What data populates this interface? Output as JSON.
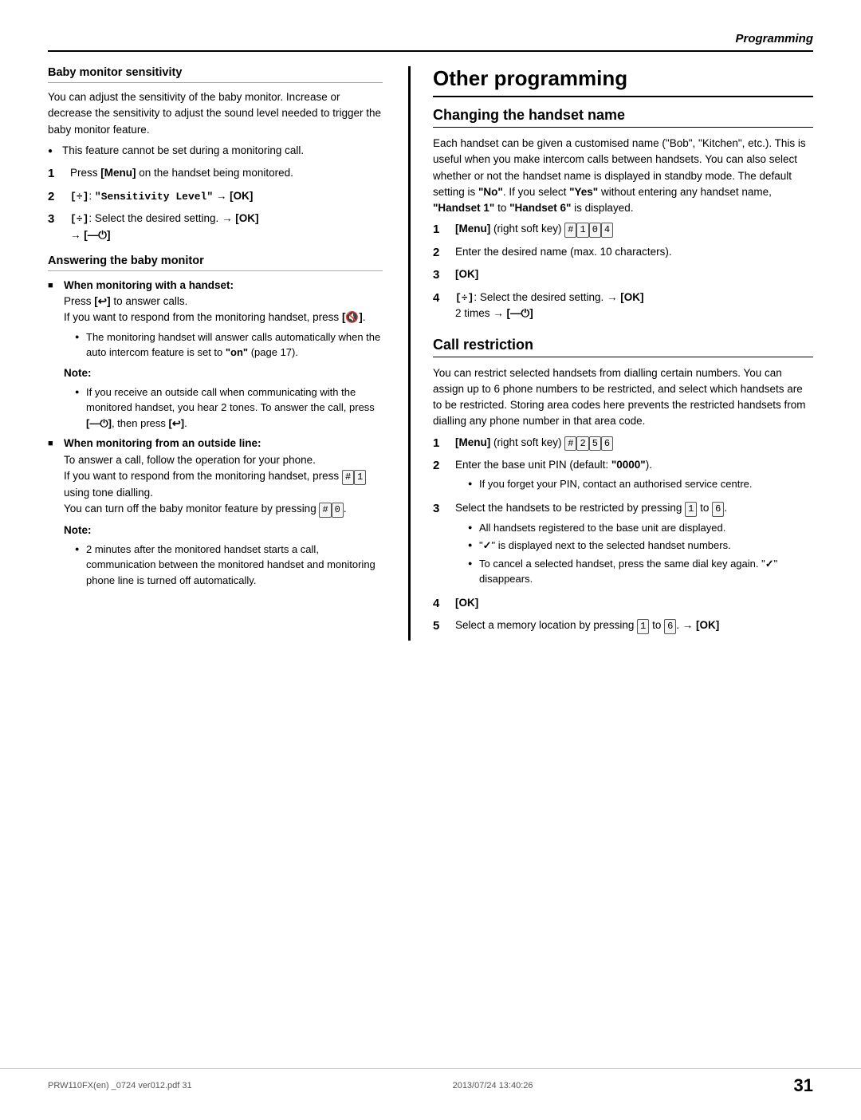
{
  "header": {
    "title": "Programming"
  },
  "left_col": {
    "baby_monitor_sensitivity": {
      "heading": "Baby monitor sensitivity",
      "body": "You can adjust the sensitivity of the baby monitor. Increase or decrease the sensitivity to adjust the sound level needed to trigger the baby monitor feature.",
      "bullets": [
        "This feature cannot be set during a monitoring call."
      ],
      "steps": [
        {
          "num": "1",
          "content": "Press [Menu] on the handset being monitored."
        },
        {
          "num": "2",
          "content": "[÷]: \"Sensitivity Level\" → [OK]",
          "mono": true
        },
        {
          "num": "3",
          "content": "[÷]: Select the desired setting. → [OK] → [—○]"
        }
      ]
    },
    "answering_baby_monitor": {
      "heading": "Answering the baby monitor",
      "sq_items": [
        {
          "bold_label": "When monitoring with a handset:",
          "text": "Press [↩] to answer calls.\nIf you want to respond from the monitoring handset, press [🔇].",
          "sub_bullets": [
            "The monitoring handset will answer calls automatically when the auto intercom feature is set to \"on\" (page 17)."
          ],
          "note": {
            "label": "Note:",
            "bullets": [
              "If you receive an outside call when communicating with the monitored handset, you hear 2 tones. To answer the call, press [—○], then press [↩]."
            ]
          }
        },
        {
          "bold_label": "When monitoring from an outside line:",
          "text": "To answer a call, follow the operation for your phone.\nIf you want to respond from the monitoring handset, press [#][1] using tone dialling.\nYou can turn off the baby monitor feature by pressing [#][0].",
          "note": {
            "label": "Note:",
            "bullets": [
              "2 minutes after the monitored handset starts a call, communication between the monitored handset and monitoring phone line is turned off automatically."
            ]
          }
        }
      ]
    }
  },
  "right_col": {
    "section_title": "Other programming",
    "changing_handset_name": {
      "heading": "Changing the handset name",
      "body": "Each handset can be given a customised name (\"Bob\", \"Kitchen\", etc.). This is useful when you make intercom calls between handsets. You can also select whether or not the handset name is displayed in standby mode. The default setting is \"No\". If you select \"Yes\" without entering any handset name, \"Handset 1\" to \"Handset 6\" is displayed.",
      "steps": [
        {
          "num": "1",
          "content": "[Menu] (right soft key) [#][1][0][4]"
        },
        {
          "num": "2",
          "content": "Enter the desired name (max. 10 characters)."
        },
        {
          "num": "3",
          "content": "[OK]"
        },
        {
          "num": "4",
          "content": "[÷]: Select the desired setting. → [OK] 2 times → [—○]"
        }
      ]
    },
    "call_restriction": {
      "heading": "Call restriction",
      "body": "You can restrict selected handsets from dialling certain numbers. You can assign up to 6 phone numbers to be restricted, and select which handsets are to be restricted. Storing area codes here prevents the restricted handsets from dialling any phone number in that area code.",
      "steps": [
        {
          "num": "1",
          "content": "[Menu] (right soft key) [#][2][5][6]"
        },
        {
          "num": "2",
          "content": "Enter the base unit PIN (default: \"0000\").",
          "sub_bullets": [
            "If you forget your PIN, contact an authorised service centre."
          ]
        },
        {
          "num": "3",
          "content": "Select the handsets to be restricted by pressing [1] to [6].",
          "sub_bullets": [
            "All handsets registered to the base unit are displayed.",
            "\"✓\" is displayed next to the selected handset numbers.",
            "To cancel a selected handset, press the same dial key again. \"✓\" disappears."
          ]
        },
        {
          "num": "4",
          "content": "[OK]"
        },
        {
          "num": "5",
          "content": "Select a memory location by pressing [1] to [6]. → [OK]"
        }
      ]
    }
  },
  "footer": {
    "file_info": "PRW110FX(en) _0724 ver012.pdf    31",
    "date_info": "2013/07/24    13:40:26",
    "page_number": "31"
  }
}
